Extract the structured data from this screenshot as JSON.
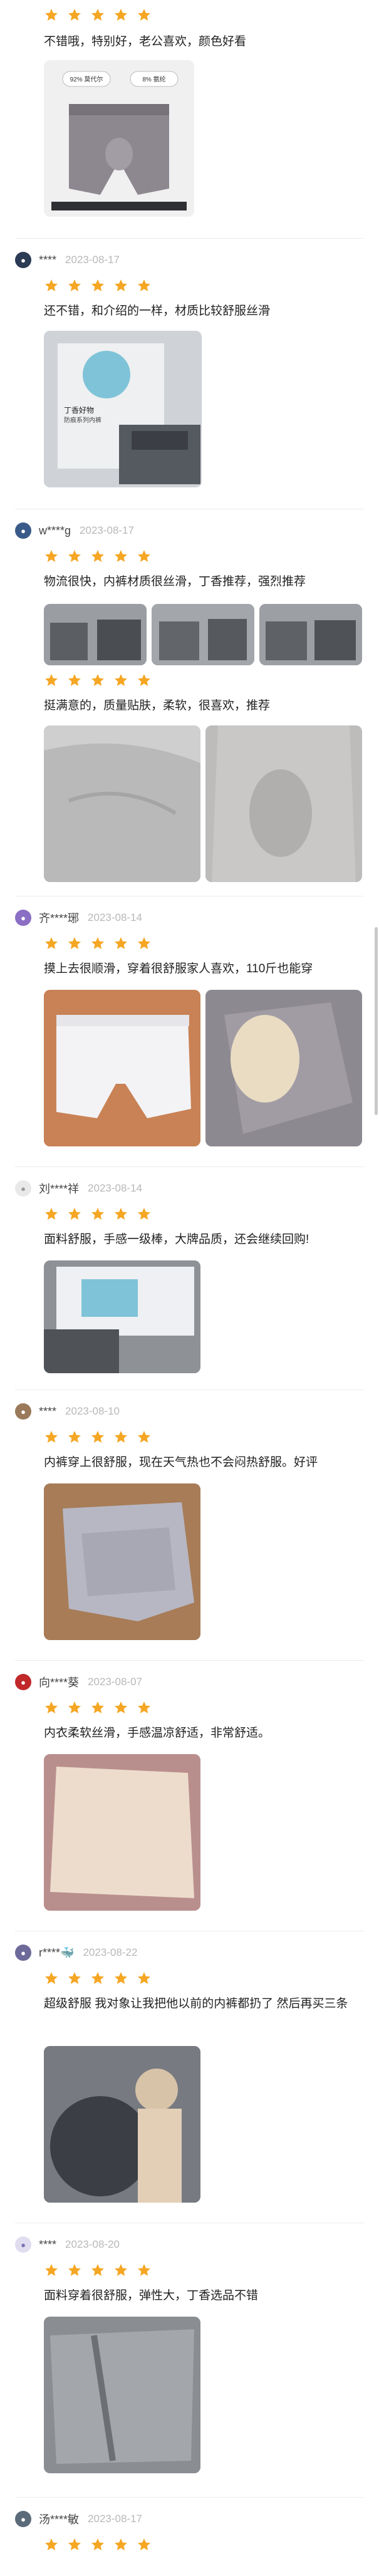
{
  "reviews": [
    {
      "username": "",
      "date": "",
      "text": "不错哦，特别好，老公喜欢，颜色好看",
      "product_tags": [
        "92% 莫代尔",
        "8% 氨纶"
      ]
    },
    {
      "username": "****",
      "date": "2023-08-17",
      "text": "还不错，和介绍的一样，材质比较舒服丝滑",
      "package_label": [
        "丁香好物",
        "防痕系列内裤"
      ]
    },
    {
      "username": "w****g",
      "date": "2023-08-17",
      "text": "物流很快，内裤材质很丝滑，丁香推荐，强烈推荐",
      "text2": "挺满意的，质量贴肤，柔软，很喜欢，推荐"
    },
    {
      "username": "齐****琊",
      "date": "2023-08-14",
      "text": "摸上去很顺滑，穿着很舒服家人喜欢，110斤也能穿"
    },
    {
      "username": "刘****祥",
      "date": "2023-08-14",
      "text": "面料舒服，手感一级棒，大牌品质，还会继续回购!"
    },
    {
      "username": "****",
      "date": "2023-08-10",
      "text": "内裤穿上很舒服，现在天气热也不会闷热舒服。好评"
    },
    {
      "username": "向****葵",
      "date": "2023-08-07",
      "text": "内衣柔软丝滑，手感温凉舒适，非常舒适。"
    },
    {
      "username": "r****🐳",
      "date": "2023-08-22",
      "text": "超级舒服 我对象让我把他以前的内裤都扔了 然后再买三条"
    },
    {
      "username": "****",
      "date": "2023-08-20",
      "text": "面料穿着很舒服，弹性大，丁香选品不错"
    },
    {
      "username": "汤****敏",
      "date": "2023-08-17",
      "text": ""
    }
  ],
  "rating": 5,
  "colors": {
    "star": "#f5a623",
    "divider": "#ececec",
    "date": "#b8b8b8"
  }
}
